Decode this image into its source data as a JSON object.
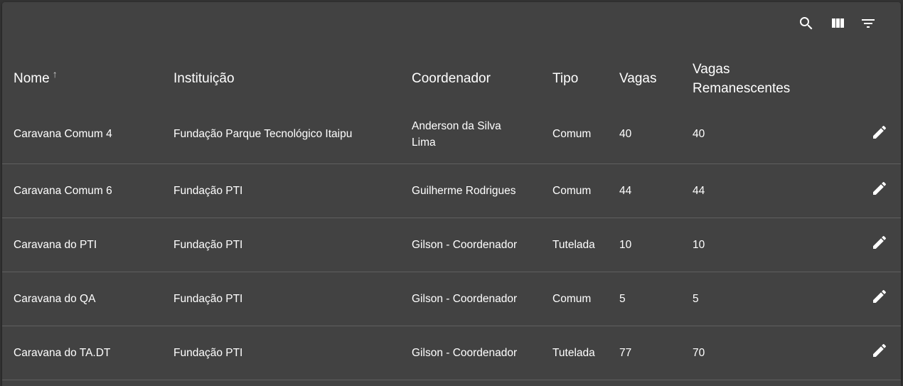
{
  "toolbar": {
    "icons": [
      "search-icon",
      "view-column-icon",
      "filter-icon"
    ]
  },
  "table": {
    "headers": {
      "nome": "Nome",
      "sort_indicator": "↑",
      "instituicao": "Instituição",
      "coordenador": "Coordenador",
      "tipo": "Tipo",
      "vagas": "Vagas",
      "vagas_remanescentes": "Vagas Remanescentes"
    },
    "rows": [
      {
        "nome": "Caravana Comum 4",
        "instituicao": "Fundação Parque Tecnológico Itaipu",
        "coordenador": "Anderson da Silva Lima",
        "tipo": "Comum",
        "vagas": "40",
        "vagas_remanescentes": "40"
      },
      {
        "nome": "Caravana Comum 6",
        "instituicao": "Fundação PTI",
        "coordenador": "Guilherme Rodrigues",
        "tipo": "Comum",
        "vagas": "44",
        "vagas_remanescentes": "44"
      },
      {
        "nome": "Caravana do PTI",
        "instituicao": "Fundação PTI",
        "coordenador": "Gilson - Coordenador",
        "tipo": "Tutelada",
        "vagas": "10",
        "vagas_remanescentes": "10"
      },
      {
        "nome": "Caravana do QA",
        "instituicao": "Fundação PTI",
        "coordenador": "Gilson - Coordenador",
        "tipo": "Comum",
        "vagas": "5",
        "vagas_remanescentes": "5"
      },
      {
        "nome": "Caravana do TA.DT",
        "instituicao": "Fundação PTI",
        "coordenador": "Gilson - Coordenador",
        "tipo": "Tutelada",
        "vagas": "77",
        "vagas_remanescentes": "70"
      }
    ],
    "row_action_icon": "edit-icon"
  },
  "colors": {
    "background": "#333333",
    "panel": "#424242",
    "divider": "#5f5f5f",
    "text": "#ffffff"
  }
}
